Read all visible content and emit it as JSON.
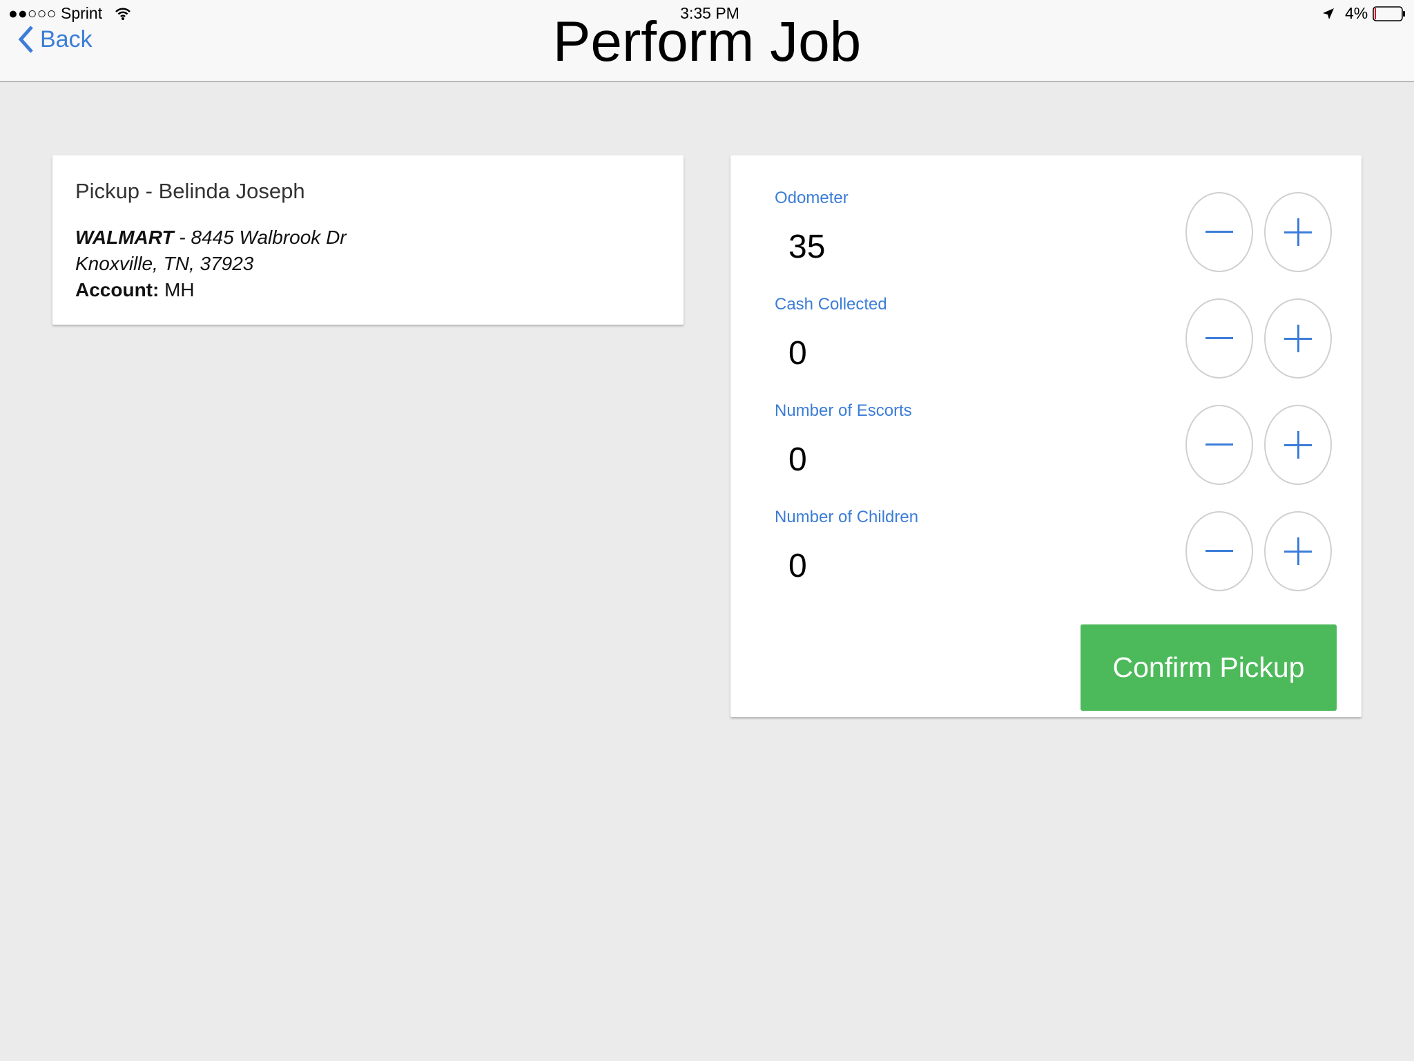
{
  "status_bar": {
    "signal": "●●○○○",
    "carrier": "Sprint",
    "time": "3:35 PM",
    "battery": "4%"
  },
  "nav": {
    "back_label": "Back",
    "title": "Perform Job"
  },
  "job": {
    "title": "Pickup - Belinda Joseph",
    "place": "WALMART",
    "address1": " - 8445 Walbrook Dr",
    "address2": "Knoxville, TN, 37923",
    "account_label": "Account:",
    "account_value": " MH"
  },
  "fields": [
    {
      "label": "Odometer",
      "value": "35"
    },
    {
      "label": "Cash Collected",
      "value": "0"
    },
    {
      "label": "Number of Escorts",
      "value": "0"
    },
    {
      "label": "Number of Children",
      "value": "0"
    }
  ],
  "confirm_label": "Confirm Pickup",
  "colors": {
    "accent": "#3b7dd8",
    "confirm": "#4cba5a",
    "background": "#ebebeb"
  }
}
